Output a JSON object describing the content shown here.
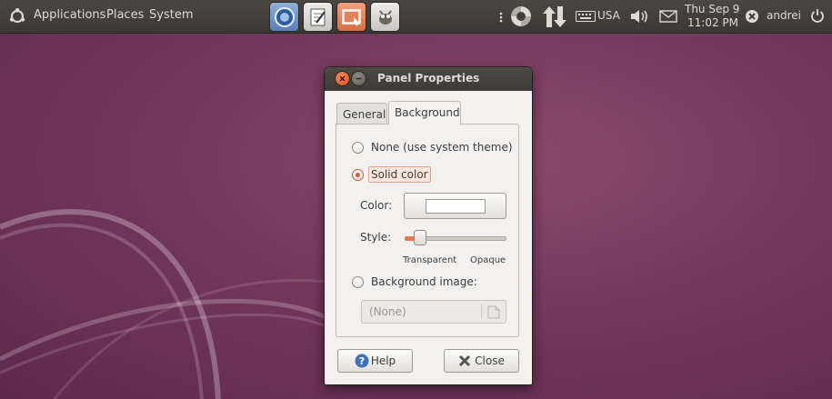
{
  "panel": {
    "menus": [
      "Applications",
      "Places",
      "System"
    ],
    "launchers": [
      {
        "name": "web-browser-icon",
        "color": "#6f95c6"
      },
      {
        "name": "text-editor-icon",
        "color": "#d8d6d2"
      },
      {
        "name": "screenshot-icon",
        "color": "#e8825a"
      },
      {
        "name": "gimp-icon",
        "color": "#d8d6d2"
      }
    ],
    "keyboard_layout": "USA",
    "clock_line1": "Thu Sep  9",
    "clock_line2": "11:02 PM",
    "username": "andrei"
  },
  "dialog": {
    "title": "Panel Properties",
    "tabs": [
      "General",
      "Background"
    ],
    "active_tab": "Background",
    "options": {
      "none_label": "None (use system theme)",
      "solid_label": "Solid color",
      "image_label": "Background image:"
    },
    "selected_option": "solid",
    "color_label": "Color:",
    "color_value": "#ffffff",
    "style_label": "Style:",
    "style_min_label": "Transparent",
    "style_max_label": "Opaque",
    "style_value": 0.1,
    "image_value": "(None)",
    "help_label": "Help",
    "close_label": "Close"
  },
  "colors": {
    "accent": "#e15a2a",
    "panel_bg": "#3c3b37",
    "desktop": "#70345a"
  }
}
